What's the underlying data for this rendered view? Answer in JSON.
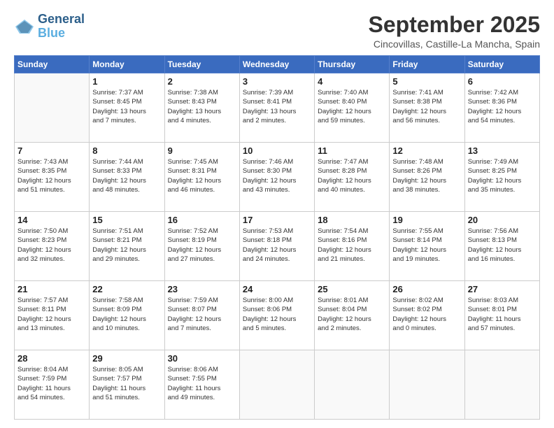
{
  "logo": {
    "text1": "General",
    "text2": "Blue"
  },
  "header": {
    "month": "September 2025",
    "location": "Cincovillas, Castille-La Mancha, Spain"
  },
  "weekdays": [
    "Sunday",
    "Monday",
    "Tuesday",
    "Wednesday",
    "Thursday",
    "Friday",
    "Saturday"
  ],
  "weeks": [
    [
      {
        "day": "",
        "info": ""
      },
      {
        "day": "1",
        "info": "Sunrise: 7:37 AM\nSunset: 8:45 PM\nDaylight: 13 hours\nand 7 minutes."
      },
      {
        "day": "2",
        "info": "Sunrise: 7:38 AM\nSunset: 8:43 PM\nDaylight: 13 hours\nand 4 minutes."
      },
      {
        "day": "3",
        "info": "Sunrise: 7:39 AM\nSunset: 8:41 PM\nDaylight: 13 hours\nand 2 minutes."
      },
      {
        "day": "4",
        "info": "Sunrise: 7:40 AM\nSunset: 8:40 PM\nDaylight: 12 hours\nand 59 minutes."
      },
      {
        "day": "5",
        "info": "Sunrise: 7:41 AM\nSunset: 8:38 PM\nDaylight: 12 hours\nand 56 minutes."
      },
      {
        "day": "6",
        "info": "Sunrise: 7:42 AM\nSunset: 8:36 PM\nDaylight: 12 hours\nand 54 minutes."
      }
    ],
    [
      {
        "day": "7",
        "info": "Sunrise: 7:43 AM\nSunset: 8:35 PM\nDaylight: 12 hours\nand 51 minutes."
      },
      {
        "day": "8",
        "info": "Sunrise: 7:44 AM\nSunset: 8:33 PM\nDaylight: 12 hours\nand 48 minutes."
      },
      {
        "day": "9",
        "info": "Sunrise: 7:45 AM\nSunset: 8:31 PM\nDaylight: 12 hours\nand 46 minutes."
      },
      {
        "day": "10",
        "info": "Sunrise: 7:46 AM\nSunset: 8:30 PM\nDaylight: 12 hours\nand 43 minutes."
      },
      {
        "day": "11",
        "info": "Sunrise: 7:47 AM\nSunset: 8:28 PM\nDaylight: 12 hours\nand 40 minutes."
      },
      {
        "day": "12",
        "info": "Sunrise: 7:48 AM\nSunset: 8:26 PM\nDaylight: 12 hours\nand 38 minutes."
      },
      {
        "day": "13",
        "info": "Sunrise: 7:49 AM\nSunset: 8:25 PM\nDaylight: 12 hours\nand 35 minutes."
      }
    ],
    [
      {
        "day": "14",
        "info": "Sunrise: 7:50 AM\nSunset: 8:23 PM\nDaylight: 12 hours\nand 32 minutes."
      },
      {
        "day": "15",
        "info": "Sunrise: 7:51 AM\nSunset: 8:21 PM\nDaylight: 12 hours\nand 29 minutes."
      },
      {
        "day": "16",
        "info": "Sunrise: 7:52 AM\nSunset: 8:19 PM\nDaylight: 12 hours\nand 27 minutes."
      },
      {
        "day": "17",
        "info": "Sunrise: 7:53 AM\nSunset: 8:18 PM\nDaylight: 12 hours\nand 24 minutes."
      },
      {
        "day": "18",
        "info": "Sunrise: 7:54 AM\nSunset: 8:16 PM\nDaylight: 12 hours\nand 21 minutes."
      },
      {
        "day": "19",
        "info": "Sunrise: 7:55 AM\nSunset: 8:14 PM\nDaylight: 12 hours\nand 19 minutes."
      },
      {
        "day": "20",
        "info": "Sunrise: 7:56 AM\nSunset: 8:13 PM\nDaylight: 12 hours\nand 16 minutes."
      }
    ],
    [
      {
        "day": "21",
        "info": "Sunrise: 7:57 AM\nSunset: 8:11 PM\nDaylight: 12 hours\nand 13 minutes."
      },
      {
        "day": "22",
        "info": "Sunrise: 7:58 AM\nSunset: 8:09 PM\nDaylight: 12 hours\nand 10 minutes."
      },
      {
        "day": "23",
        "info": "Sunrise: 7:59 AM\nSunset: 8:07 PM\nDaylight: 12 hours\nand 7 minutes."
      },
      {
        "day": "24",
        "info": "Sunrise: 8:00 AM\nSunset: 8:06 PM\nDaylight: 12 hours\nand 5 minutes."
      },
      {
        "day": "25",
        "info": "Sunrise: 8:01 AM\nSunset: 8:04 PM\nDaylight: 12 hours\nand 2 minutes."
      },
      {
        "day": "26",
        "info": "Sunrise: 8:02 AM\nSunset: 8:02 PM\nDaylight: 12 hours\nand 0 minutes."
      },
      {
        "day": "27",
        "info": "Sunrise: 8:03 AM\nSunset: 8:01 PM\nDaylight: 11 hours\nand 57 minutes."
      }
    ],
    [
      {
        "day": "28",
        "info": "Sunrise: 8:04 AM\nSunset: 7:59 PM\nDaylight: 11 hours\nand 54 minutes."
      },
      {
        "day": "29",
        "info": "Sunrise: 8:05 AM\nSunset: 7:57 PM\nDaylight: 11 hours\nand 51 minutes."
      },
      {
        "day": "30",
        "info": "Sunrise: 8:06 AM\nSunset: 7:55 PM\nDaylight: 11 hours\nand 49 minutes."
      },
      {
        "day": "",
        "info": ""
      },
      {
        "day": "",
        "info": ""
      },
      {
        "day": "",
        "info": ""
      },
      {
        "day": "",
        "info": ""
      }
    ]
  ]
}
